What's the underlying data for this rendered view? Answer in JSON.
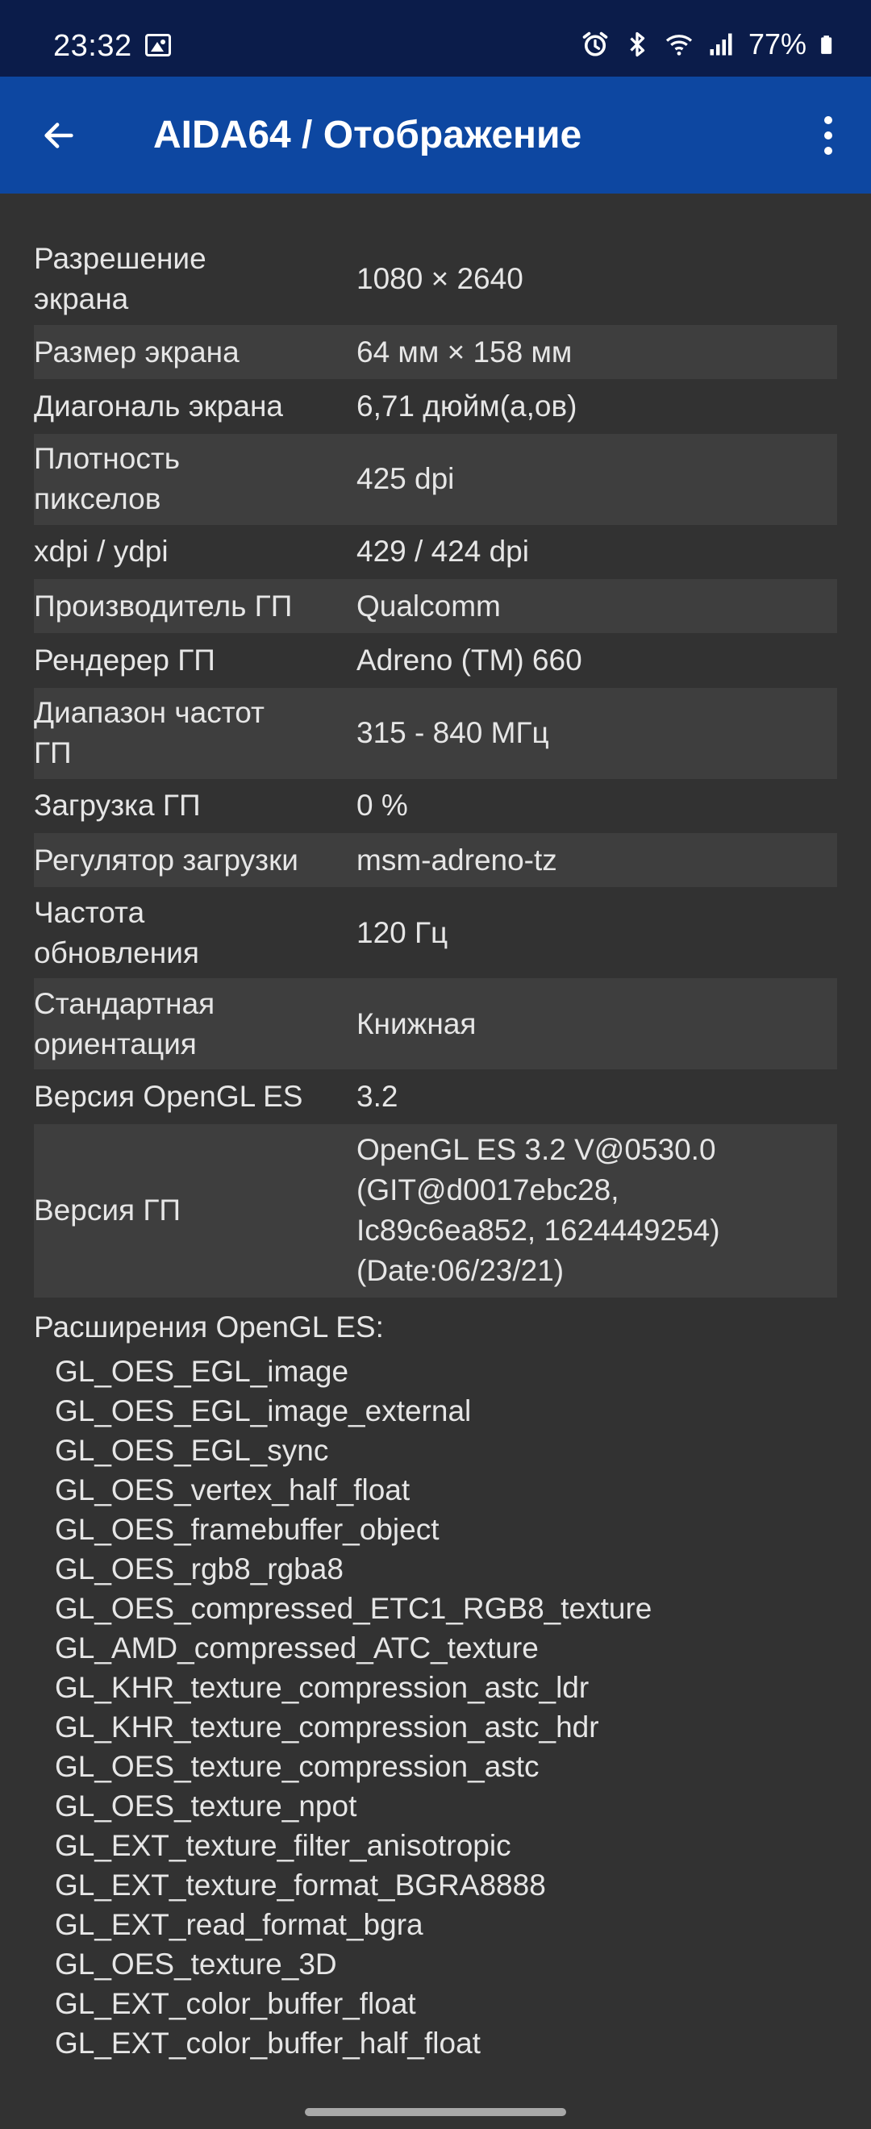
{
  "status_bar": {
    "time": "23:32",
    "battery": "77%",
    "icons": [
      "image-icon",
      "alarm-icon",
      "bluetooth-icon",
      "wifi-icon",
      "signal-icon",
      "battery-icon"
    ]
  },
  "app_bar": {
    "title": "AIDA64  /  Отображение",
    "back_icon": "arrow-left-icon",
    "menu_icon": "more-vert-icon"
  },
  "colors": {
    "status_bar_bg": "#0b1c4a",
    "app_bar_bg": "#0d47a1",
    "page_bg": "#323232",
    "row_alt_bg": "#3e3e3e",
    "text": "#e6e6e6"
  },
  "properties": [
    {
      "key": "Разрешение\nэкрана",
      "value": "1080 × 2640"
    },
    {
      "key": "Размер экрана",
      "value": "64 мм × 158 мм"
    },
    {
      "key": "Диагональ экрана",
      "value": "6,71 дюйм(а,ов)"
    },
    {
      "key": "Плотность\nпикселов",
      "value": "425 dpi"
    },
    {
      "key": "xdpi / ydpi",
      "value": "429 / 424 dpi"
    },
    {
      "key": "Производитель ГП",
      "value": "Qualcomm"
    },
    {
      "key": "Рендерер ГП",
      "value": "Adreno (TM) 660"
    },
    {
      "key": "Диапазон частот\nГП",
      "value": "315 - 840 МГц"
    },
    {
      "key": "Загрузка ГП",
      "value": "0 %"
    },
    {
      "key": "Регулятор загрузки",
      "value": "msm-adreno-tz"
    },
    {
      "key": "Частота\nобновления",
      "value": "120 Гц"
    },
    {
      "key": "Стандартная\nориентация",
      "value": "Книжная"
    },
    {
      "key": "Версия OpenGL ES",
      "value": "3.2"
    },
    {
      "key": "Версия ГП",
      "value": "OpenGL ES 3.2 V@0530.0\n(GIT@d0017ebc28,\nIc89c6ea852, 1624449254)\n(Date:06/23/21)"
    }
  ],
  "extensions": {
    "title": "Расширения OpenGL ES:",
    "items": [
      "GL_OES_EGL_image",
      "GL_OES_EGL_image_external",
      "GL_OES_EGL_sync",
      "GL_OES_vertex_half_float",
      "GL_OES_framebuffer_object",
      "GL_OES_rgb8_rgba8",
      "GL_OES_compressed_ETC1_RGB8_texture",
      "GL_AMD_compressed_ATC_texture",
      "GL_KHR_texture_compression_astc_ldr",
      "GL_KHR_texture_compression_astc_hdr",
      "GL_OES_texture_compression_astc",
      "GL_OES_texture_npot",
      "GL_EXT_texture_filter_anisotropic",
      "GL_EXT_texture_format_BGRA8888",
      "GL_EXT_read_format_bgra",
      "GL_OES_texture_3D",
      "GL_EXT_color_buffer_float",
      "GL_EXT_color_buffer_half_float"
    ]
  }
}
